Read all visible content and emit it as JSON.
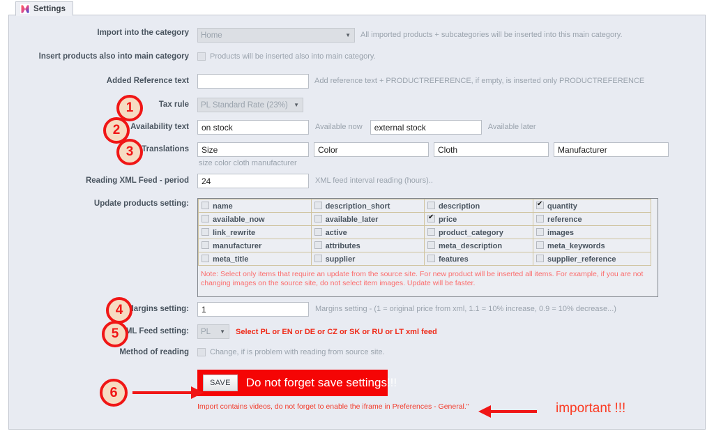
{
  "window": {
    "tab_label": "Settings",
    "tab_icon": "module-logo-icon"
  },
  "colors": {
    "panel_bg": "#e8ebf2",
    "label_text": "#4a5560",
    "hint_text": "#9aa3ad",
    "alert_red": "#f50505",
    "note_red": "#fb6d6d",
    "annotation_red": "#f01616",
    "annotation_fill": "#f6dcc2"
  },
  "form": {
    "import_category": {
      "label": "Import into the category",
      "value": "Home",
      "options": [
        "Home"
      ],
      "hint": "All imported products + subcategories will be inserted into this main category."
    },
    "insert_main_category": {
      "label": "Insert products also into main category",
      "checked": false,
      "checkbox_label": "Products will be inserted also into main category."
    },
    "added_reference_text": {
      "label": "Added Reference text",
      "value": "",
      "placeholder": "",
      "hint": "Add reference text + PRODUCTREFERENCE, if empty, is inserted only PRODUCTREFERENCE"
    },
    "tax_rule": {
      "label": "Tax rule",
      "value": "PL Standard Rate (23%)",
      "options": [
        "PL Standard Rate (23%)"
      ]
    },
    "availability_text": {
      "label": "Availability text",
      "fields": [
        {
          "value": "on stock",
          "hint": "Available now"
        },
        {
          "value": "external stock",
          "hint": "Available later"
        }
      ]
    },
    "translations": {
      "label": "Translations",
      "values": [
        "Size",
        "Color",
        "Cloth",
        "Manufacturer"
      ],
      "hint": "size color cloth manufacturer"
    },
    "reading_period": {
      "label": "Reading XML Feed - period",
      "value": "24",
      "hint": "XML feed interval reading (hours).."
    },
    "update_products": {
      "label": "Update products setting:",
      "rows": [
        [
          {
            "name": "name",
            "checked": false
          },
          {
            "name": "description_short",
            "checked": false
          },
          {
            "name": "description",
            "checked": false
          },
          {
            "name": "quantity",
            "checked": true
          }
        ],
        [
          {
            "name": "available_now",
            "checked": false
          },
          {
            "name": "available_later",
            "checked": false
          },
          {
            "name": "price",
            "checked": true
          },
          {
            "name": "reference",
            "checked": false
          }
        ],
        [
          {
            "name": "link_rewrite",
            "checked": false
          },
          {
            "name": "active",
            "checked": false
          },
          {
            "name": "product_category",
            "checked": false
          },
          {
            "name": "images",
            "checked": false
          }
        ],
        [
          {
            "name": "manufacturer",
            "checked": false
          },
          {
            "name": "attributes",
            "checked": false
          },
          {
            "name": "meta_description",
            "checked": false
          },
          {
            "name": "meta_keywords",
            "checked": false
          }
        ],
        [
          {
            "name": "meta_title",
            "checked": false
          },
          {
            "name": "supplier",
            "checked": false
          },
          {
            "name": "features",
            "checked": false
          },
          {
            "name": "supplier_reference",
            "checked": false
          }
        ]
      ],
      "note": "Note: Select only items that require an update from the source site. For new product will be inserted all items. For example, if you are not changing images on the source site, do not select item images. Update will be faster."
    },
    "margins_setting": {
      "label": "Margins setting:",
      "value": "1",
      "hint": "Margins setting - (1 = original price from xml, 1.1 = 10% increase, 0.9 = 10% decrease...)"
    },
    "xml_feed_setting": {
      "label": "XML Feed setting:",
      "value": "PL",
      "options": [
        "PL",
        "EN",
        "DE",
        "CZ",
        "SK",
        "RU",
        "LT"
      ],
      "hint": "Select PL or EN or DE or CZ or SK or RU or LT xml feed"
    },
    "method_of_reading": {
      "label": "Method of reading",
      "checked": false,
      "checkbox_label": "Change, if is problem with reading from source site."
    }
  },
  "save": {
    "button_label": "SAVE",
    "banner_text": "Do not forget save settings!!!",
    "iframe_note": "Import contains videos, do not forget to enable the iframe in Preferences - General.\"",
    "important_label": "important !!!"
  },
  "annotations": {
    "markers": [
      {
        "number": "1",
        "target": "tax-rule-row"
      },
      {
        "number": "2",
        "target": "availability-text-row"
      },
      {
        "number": "3",
        "target": "translations-row"
      },
      {
        "number": "4",
        "target": "margins-setting-row"
      },
      {
        "number": "5",
        "target": "xml-feed-setting-row"
      },
      {
        "number": "6",
        "target": "save-button"
      }
    ]
  }
}
